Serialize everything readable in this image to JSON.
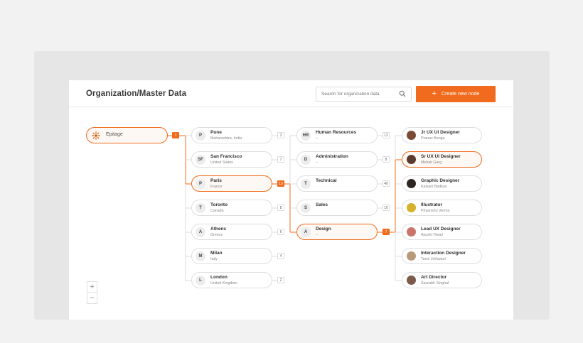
{
  "header": {
    "title": "Organization/Master Data",
    "search_placeholder": "Search for organization data",
    "create_label": "Create new node"
  },
  "root": {
    "name": "Epitage",
    "count": "7"
  },
  "cities": [
    {
      "initials": "P",
      "name": "Pune",
      "sub": "Maharashtra, India",
      "count": "3"
    },
    {
      "initials": "SF",
      "name": "San Francisco",
      "sub": "United States",
      "count": "7"
    },
    {
      "initials": "P",
      "name": "Paris",
      "sub": "France",
      "count": "10"
    },
    {
      "initials": "T",
      "name": "Toronto",
      "sub": "Canada",
      "count": "8"
    },
    {
      "initials": "A",
      "name": "Athens",
      "sub": "Greece",
      "count": "6"
    },
    {
      "initials": "M",
      "name": "Milan",
      "sub": "Italy",
      "count": "4"
    },
    {
      "initials": "L",
      "name": "London",
      "sub": "United Kingdom",
      "count": "2"
    }
  ],
  "departments": [
    {
      "initials": "HR",
      "name": "Human Resources",
      "sub": "–",
      "count": "12"
    },
    {
      "initials": "D",
      "name": "Administration",
      "sub": "–",
      "count": "8"
    },
    {
      "initials": "T",
      "name": "Technical",
      "sub": "",
      "count": "40"
    },
    {
      "initials": "S",
      "name": "Sales",
      "sub": "",
      "count": "10"
    },
    {
      "initials": "A",
      "name": "Design",
      "sub": "–",
      "count": "7"
    }
  ],
  "people": [
    {
      "name": "Jr UX UI Designer",
      "sub": "Pranav Banga",
      "color": "#7a4b34"
    },
    {
      "name": "Sr UX UI Designer",
      "sub": "Mehak Garg",
      "color": "#5a3a2e"
    },
    {
      "name": "Graphic Designer",
      "sub": "Kalyani Badkas",
      "color": "#2d2522"
    },
    {
      "name": "Illustrator",
      "sub": "Priyanshu Verma",
      "color": "#d6b12a"
    },
    {
      "name": "Lead UX Designer",
      "sub": "Ayushi Tiwari",
      "color": "#c9756a"
    },
    {
      "name": "Interaction Designer",
      "sub": "Tanvi Jethwani",
      "color": "#b89a7a"
    },
    {
      "name": "Art Director",
      "sub": "Saurabh Singhal",
      "color": "#7d5a49"
    }
  ],
  "colors": {
    "accent": "#f06b1e"
  },
  "icons": {
    "search": "search-icon",
    "plus": "plus-icon",
    "zoom_in": "zoom-in-icon",
    "zoom_out": "zoom-out-icon"
  },
  "zoom": {
    "in": "+",
    "out": "–"
  }
}
